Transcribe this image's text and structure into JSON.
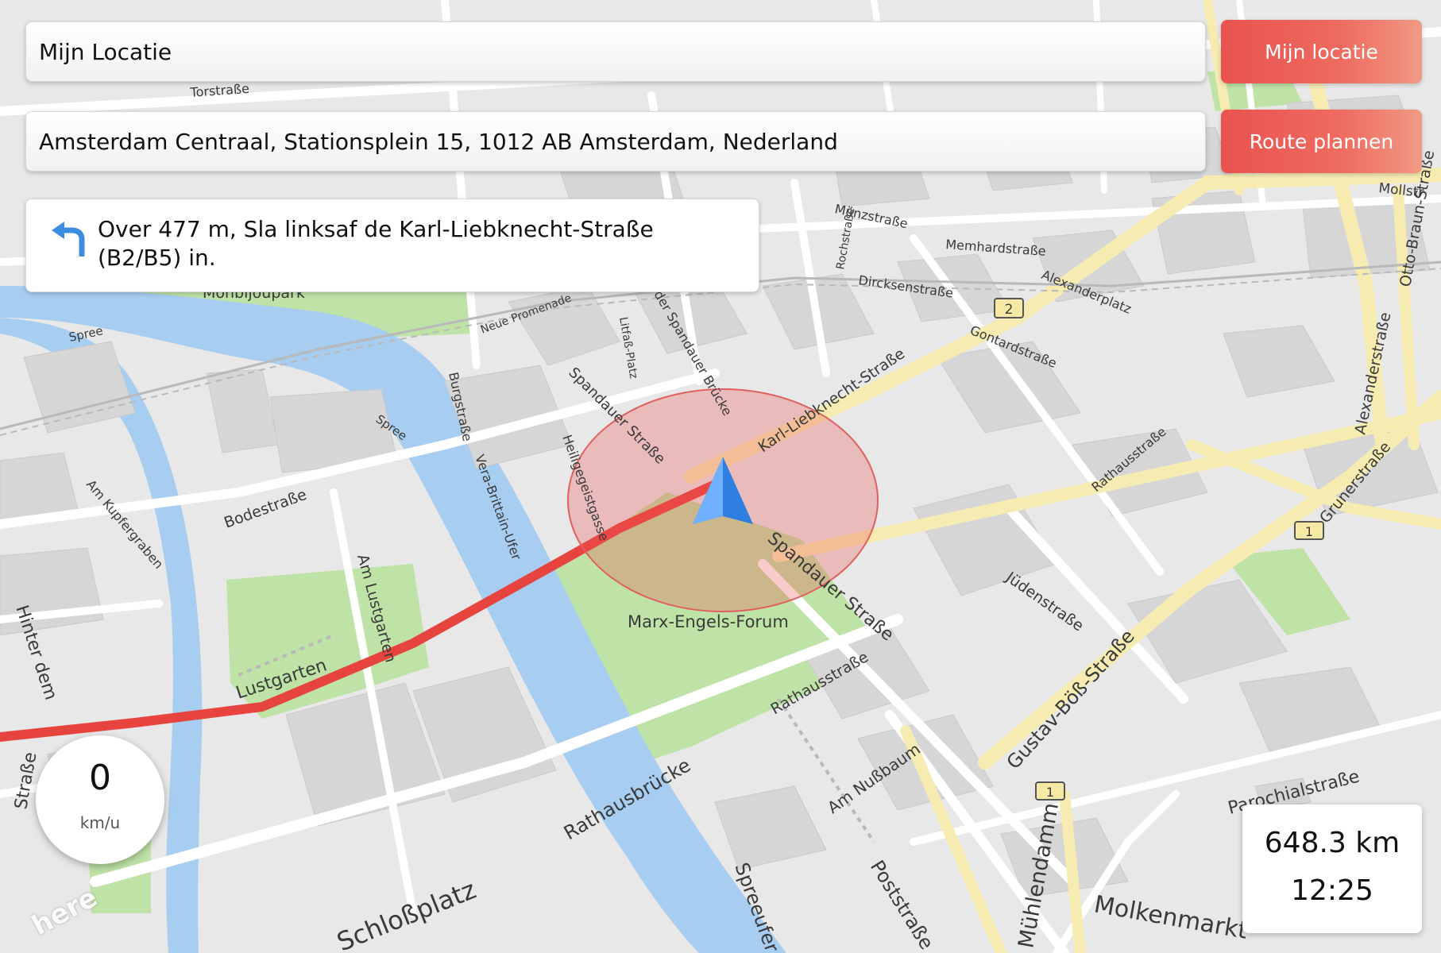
{
  "origin": {
    "value": "Mijn Locatie"
  },
  "destination": {
    "value": "Amsterdam Centraal, Stationsplein 15, 1012 AB Amsterdam, Nederland"
  },
  "buttons": {
    "my_location": "Mijn locatie",
    "plan_route": "Route plannen"
  },
  "instruction": {
    "text": "Over 477 m, Sla linksaf de Karl-Liebknecht-Straße (B2/B5) in.",
    "icon": "turn-left-icon"
  },
  "speed": {
    "value": "0",
    "unit": "km/u"
  },
  "trip": {
    "distance": "648.3 km",
    "time": "12:25"
  },
  "brand": "here",
  "map": {
    "park_labels": {
      "monbijou": "Monbijoupark",
      "lustgarten": "Lustgarten",
      "marx_engels": "Marx-Engels-Forum",
      "alexanderplatz": "Alexanderplatz"
    },
    "water_labels": [
      "Spree",
      "Spree"
    ],
    "street_labels": {
      "torstrasse": "Torstraße",
      "muenzstrasse": "Münzstraße",
      "memhardstrasse": "Memhardstraße",
      "dircksenstrasse": "Dircksenstraße",
      "gontardstrasse": "Gontardstraße",
      "karl_liebknecht": "Karl-Liebknecht-Straße",
      "spandauer_1": "Spandauer Straße",
      "spandauer_2": "Spandauer Straße",
      "spandauer_bruecke": "der Spandauer Brücke",
      "heiligegeistgasse": "Heiligegeistgasse",
      "burgstrasse": "Burgstraße",
      "vera_brittain": "Vera-Brittain-Ufer",
      "bodestrasse": "Bodestraße",
      "am_kupfergraben": "Am Kupfergraben",
      "am_lustgarten": "Am Lustgarten",
      "rathausstrasse_1": "Rathausstraße",
      "rathausstrasse_2": "Rathausstraße",
      "juedenstrasse": "Jüdenstraße",
      "grunerstrasse": "Grunerstraße",
      "alexanderstrasse": "Alexanderstraße",
      "otto_braun": "Otto-Braun-Straße",
      "gustav_boess": "Gustav-Böß-Straße",
      "rathausbruecke": "Rathausbrücke",
      "am_nussbaum": "Am Nußbaum",
      "poststrasse": "Poststraße",
      "spreeufer": "Spreeufer",
      "muehlendamm": "Mühlendamm",
      "molkenmarkt": "Molkenmarkt",
      "parochialstrasse": "Parochialstraße",
      "schlossplatz": "Schloßplatz",
      "neue_promenade": "Neue Promenade",
      "litfass_platz": "Litfaß-Platz",
      "rochstrasse": "Rochstraße",
      "hinter_dem": "Hinter dem",
      "strasse_left": "Straße",
      "mollstrasse": "Mollstr"
    },
    "route_shields": [
      "2",
      "1",
      "1"
    ]
  }
}
